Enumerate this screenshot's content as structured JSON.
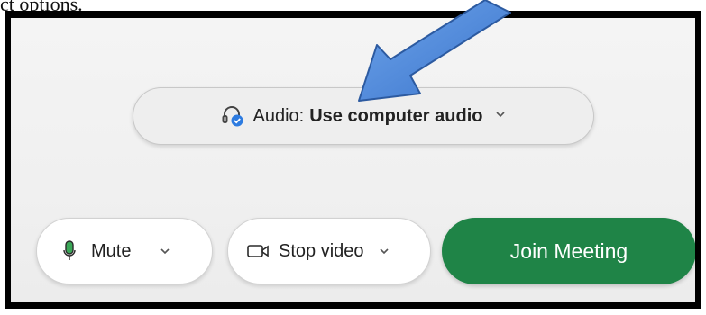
{
  "top_text": "ct options.",
  "audio": {
    "label": "Audio:",
    "value": "Use computer audio"
  },
  "controls": {
    "mute_label": "Mute",
    "video_label": "Stop video",
    "join_label": "Join Meeting"
  },
  "icons": {
    "headset": "headset-icon",
    "mic": "microphone-icon",
    "camera": "video-camera-icon",
    "chevron": "chevron-down-icon",
    "arrow": "annotation-arrow"
  },
  "colors": {
    "join_green": "#1f8447",
    "arrow_blue": "#4a86d9",
    "mic_green": "#3aa757",
    "check_blue": "#2d7be0"
  }
}
